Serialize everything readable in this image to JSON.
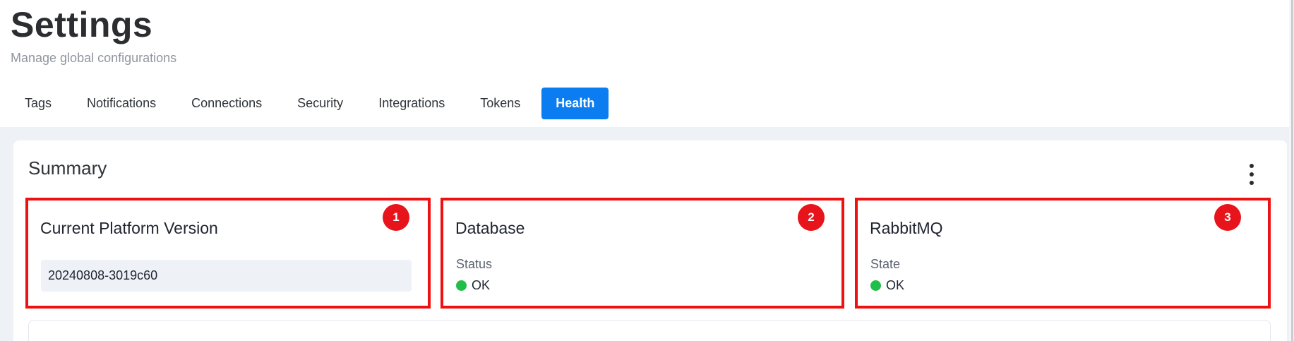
{
  "header": {
    "title": "Settings",
    "subtitle": "Manage global configurations"
  },
  "tabs": [
    {
      "label": "Tags",
      "active": false
    },
    {
      "label": "Notifications",
      "active": false
    },
    {
      "label": "Connections",
      "active": false
    },
    {
      "label": "Security",
      "active": false
    },
    {
      "label": "Integrations",
      "active": false
    },
    {
      "label": "Tokens",
      "active": false
    },
    {
      "label": "Health",
      "active": true
    }
  ],
  "summary": {
    "title": "Summary",
    "menu_icon": "kebab-menu-icon",
    "panels": {
      "platform": {
        "badge": "1",
        "title": "Current Platform Version",
        "version": "20240808-3019c60"
      },
      "database": {
        "badge": "2",
        "title": "Database",
        "status_label": "Status",
        "status_value": "OK",
        "status_color": "#1fbf4a"
      },
      "rabbitmq": {
        "badge": "3",
        "title": "RabbitMQ",
        "status_label": "State",
        "status_value": "OK",
        "status_color": "#1fbf4a"
      }
    }
  },
  "colors": {
    "accent": "#0b7df0",
    "highlight": "#ee1111",
    "badge": "#e8141b",
    "status_ok": "#1fbf4a"
  }
}
